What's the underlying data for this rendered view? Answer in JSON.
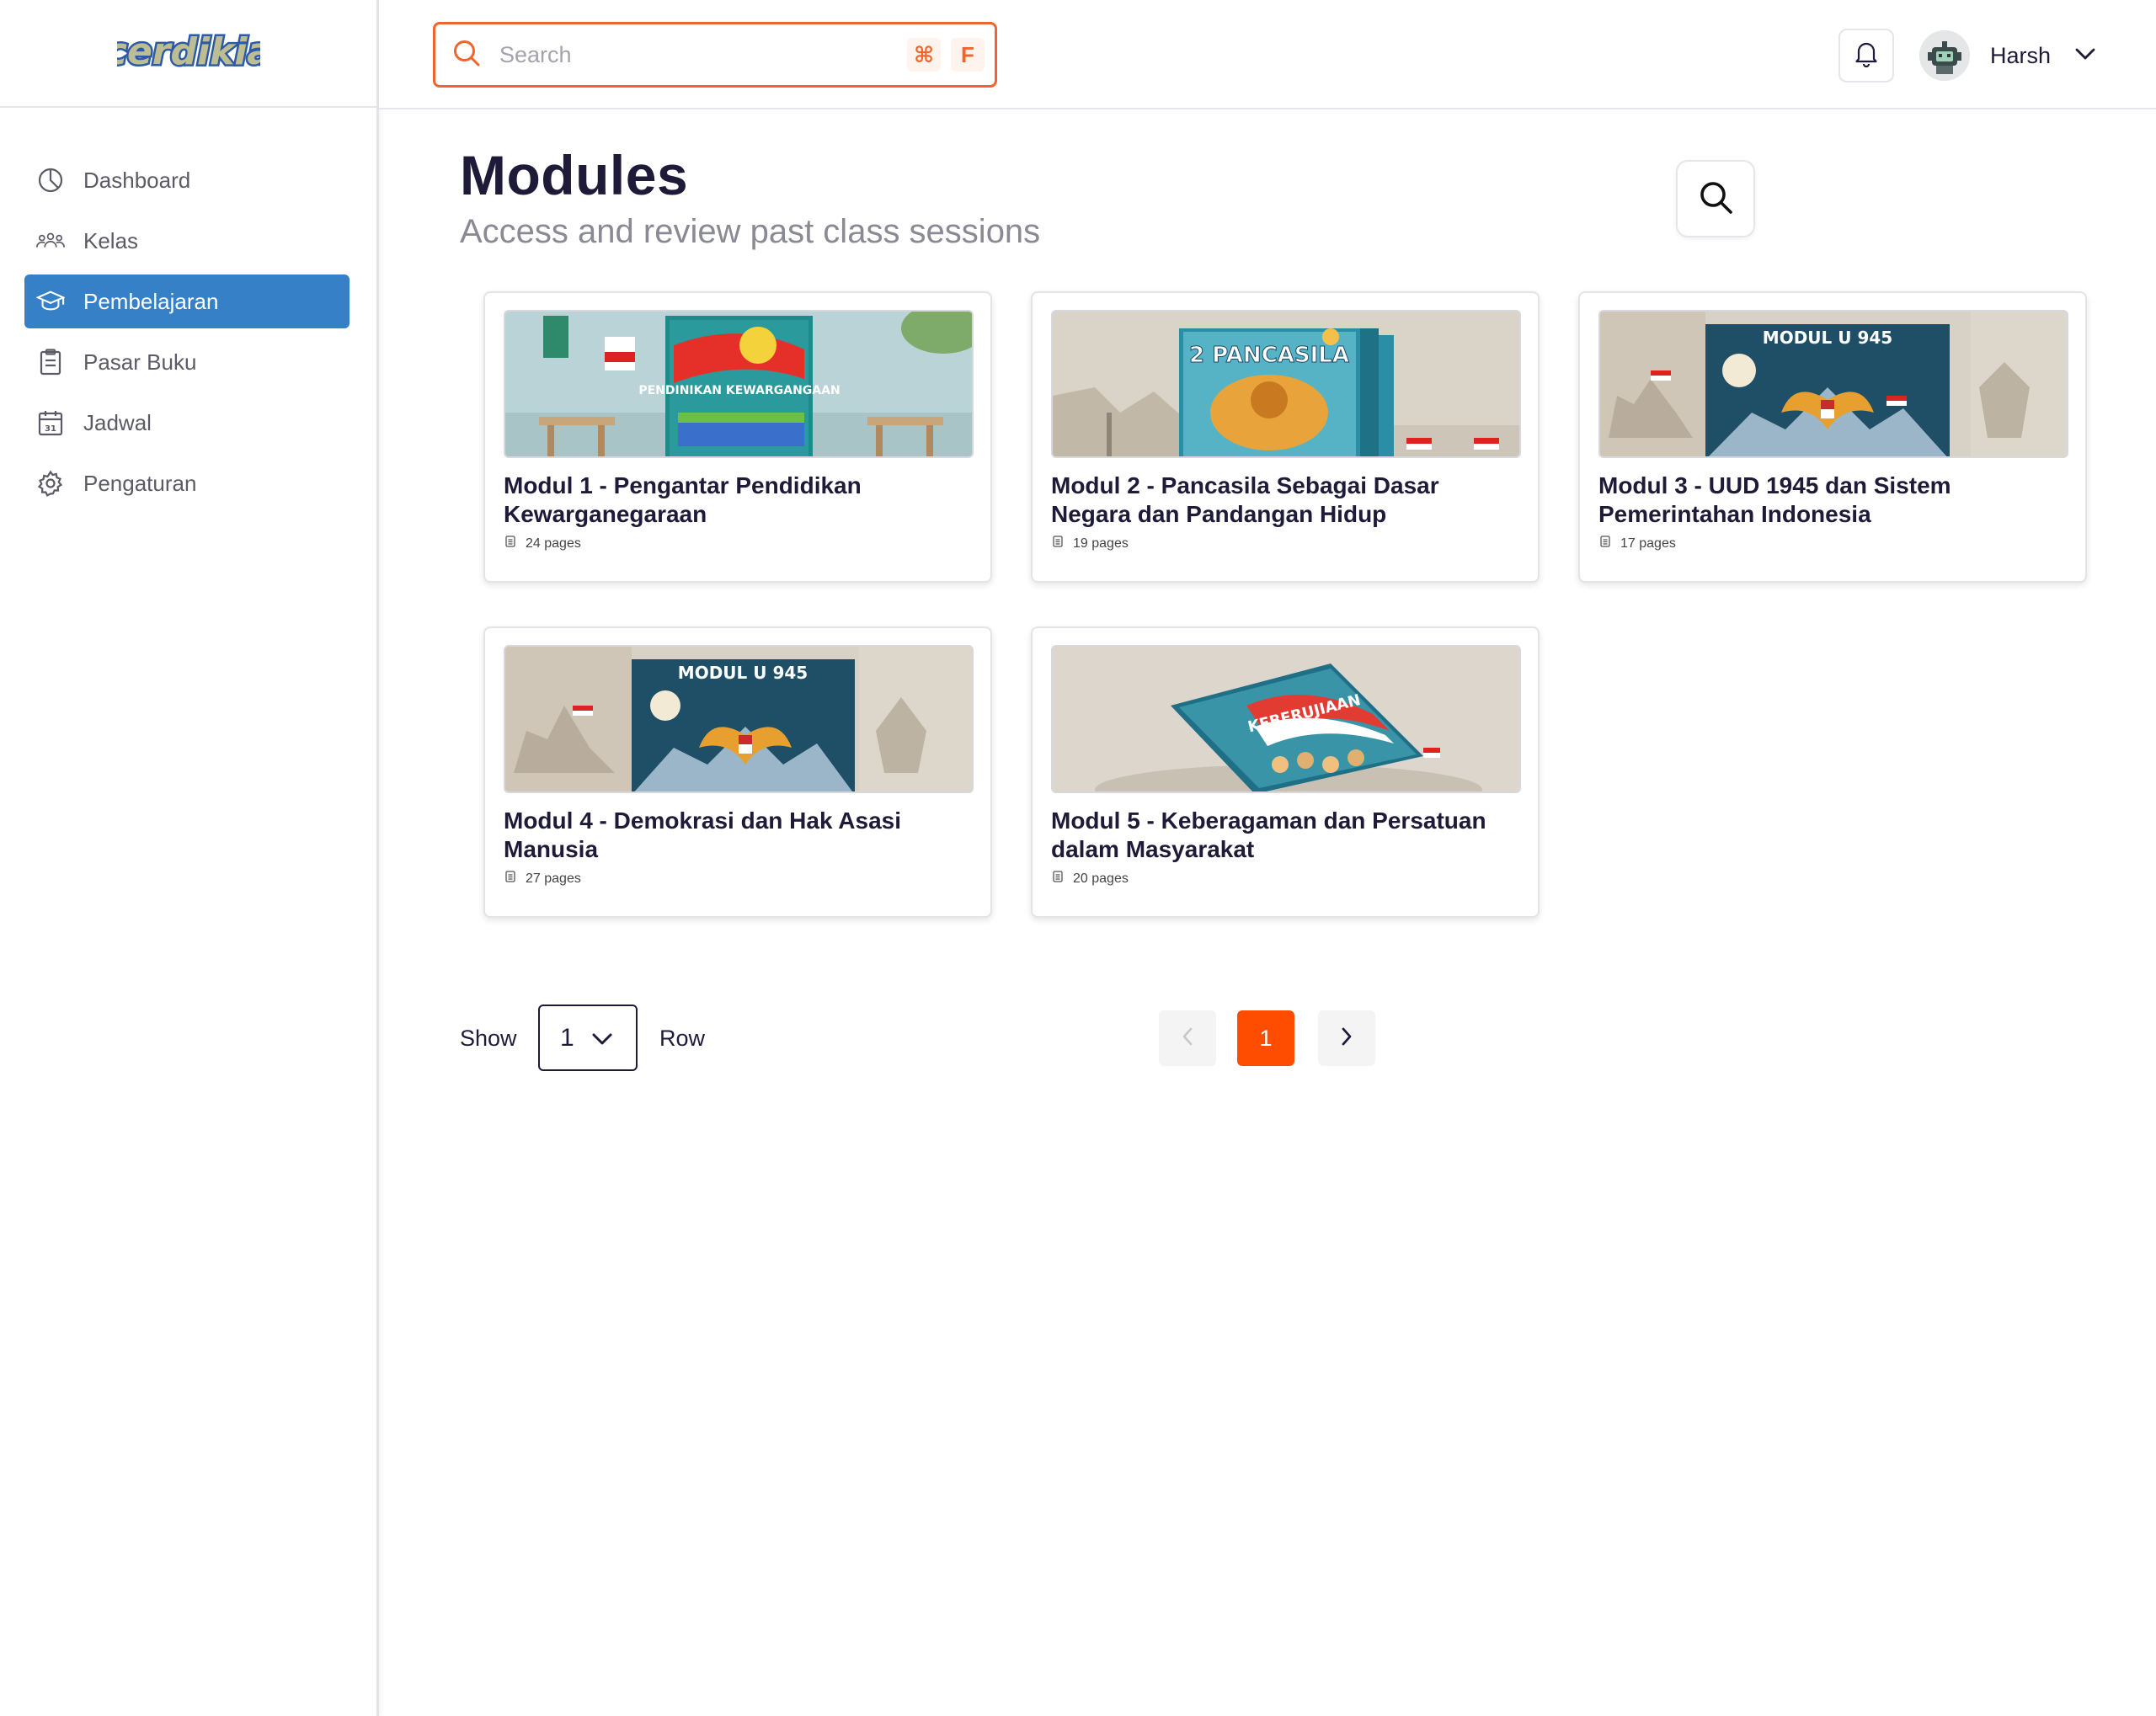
{
  "app": {
    "logo_text": "cerdikia"
  },
  "sidebar": {
    "items": [
      {
        "label": "Dashboard",
        "icon": "dashboard-pie-icon",
        "active": false
      },
      {
        "label": "Kelas",
        "icon": "users-group-icon",
        "active": false
      },
      {
        "label": "Pembelajaran",
        "icon": "graduation-cap-icon",
        "active": true
      },
      {
        "label": "Pasar Buku",
        "icon": "clipboard-icon",
        "active": false
      },
      {
        "label": "Jadwal",
        "icon": "calendar-icon",
        "active": false
      },
      {
        "label": "Pengaturan",
        "icon": "gear-icon",
        "active": false
      }
    ]
  },
  "header": {
    "search_placeholder": "Search",
    "shortcut_key_1": "⌘",
    "shortcut_key_2": "F",
    "user_name": "Harsh"
  },
  "main": {
    "title": "Modules",
    "subtitle": "Access and review past class sessions",
    "modules": [
      {
        "title": "Modul 1 - Pengantar Pendidikan Kewarganegaraan",
        "pages": "24 pages",
        "cover_text": "PENDINIKAN KEWARGANGAAN"
      },
      {
        "title": "Modul 2 - Pancasila Sebagai Dasar Negara dan Pandangan Hidup",
        "pages": "19 pages",
        "cover_text": "2 PANCASILA"
      },
      {
        "title": "Modul 3 - UUD 1945 dan Sistem Pemerintahan Indonesia",
        "pages": "17 pages",
        "cover_text": "MODUL U 945"
      },
      {
        "title": "Modul 4 - Demokrasi dan Hak Asasi Manusia",
        "pages": "27 pages",
        "cover_text": "MODUL U 945"
      },
      {
        "title": "Modul 5 - Keberagaman dan Persatuan dalam Masyarakat",
        "pages": "20 pages",
        "cover_text": "KEBERUJIAAN"
      }
    ]
  },
  "pagination": {
    "show_label": "Show",
    "rows_value": "1",
    "row_label": "Row",
    "current_page": "1"
  },
  "colors": {
    "accent_orange": "#ff4d00",
    "sidebar_active": "#3680c7",
    "title_text": "#1e1b39"
  }
}
